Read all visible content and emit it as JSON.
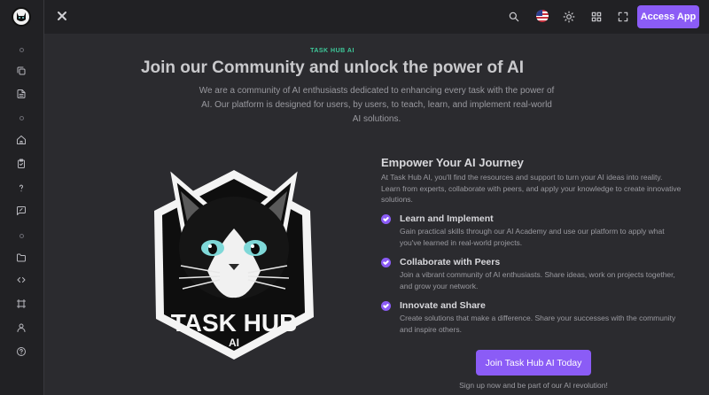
{
  "topbar": {
    "access_label": "Access App",
    "icons": [
      "search-icon",
      "us-flag-icon",
      "sun-icon",
      "grid-icon",
      "fullscreen-icon"
    ]
  },
  "sidebar": {
    "icons": [
      "copy-icon",
      "document-icon",
      "home-icon",
      "clipboard-check-icon",
      "help-icon",
      "message-edit-icon",
      "folder-icon",
      "code-icon",
      "frame-icon",
      "user-icon",
      "question-circle-icon"
    ]
  },
  "hero": {
    "eyebrow": "TASK HUB AI",
    "headline": "Join our Community and unlock the power of AI",
    "intro": "We are a community of AI enthusiasts dedicated to enhancing every task with the power of AI. Our platform is designed for users, by users, to teach, learn, and implement real-world AI solutions."
  },
  "logo": {
    "line1": "TASK HUB",
    "line2": "AI"
  },
  "journey": {
    "title": "Empower Your AI Journey",
    "text": "At Task Hub AI, you'll find the resources and support to turn your AI ideas into reality. Learn from experts, collaborate with peers, and apply your knowledge to create innovative solutions.",
    "features": [
      {
        "title": "Learn and Implement",
        "text": "Gain practical skills through our AI Academy and use our platform to apply what you've learned in real-world projects."
      },
      {
        "title": "Collaborate with Peers",
        "text": "Join a vibrant community of AI enthusiasts. Share ideas, work on projects together, and grow your network."
      },
      {
        "title": "Innovate and Share",
        "text": "Create solutions that make a difference. Share your successes with the community and inspire others."
      }
    ]
  },
  "cta": {
    "button": "Join Task Hub AI Today",
    "note": "Sign up now and be part of our AI revolution!"
  },
  "colors": {
    "accent": "#8b5cf6",
    "eyebrow": "#3ec99a",
    "background": "#2b2b2f",
    "sidebar": "#212124"
  }
}
